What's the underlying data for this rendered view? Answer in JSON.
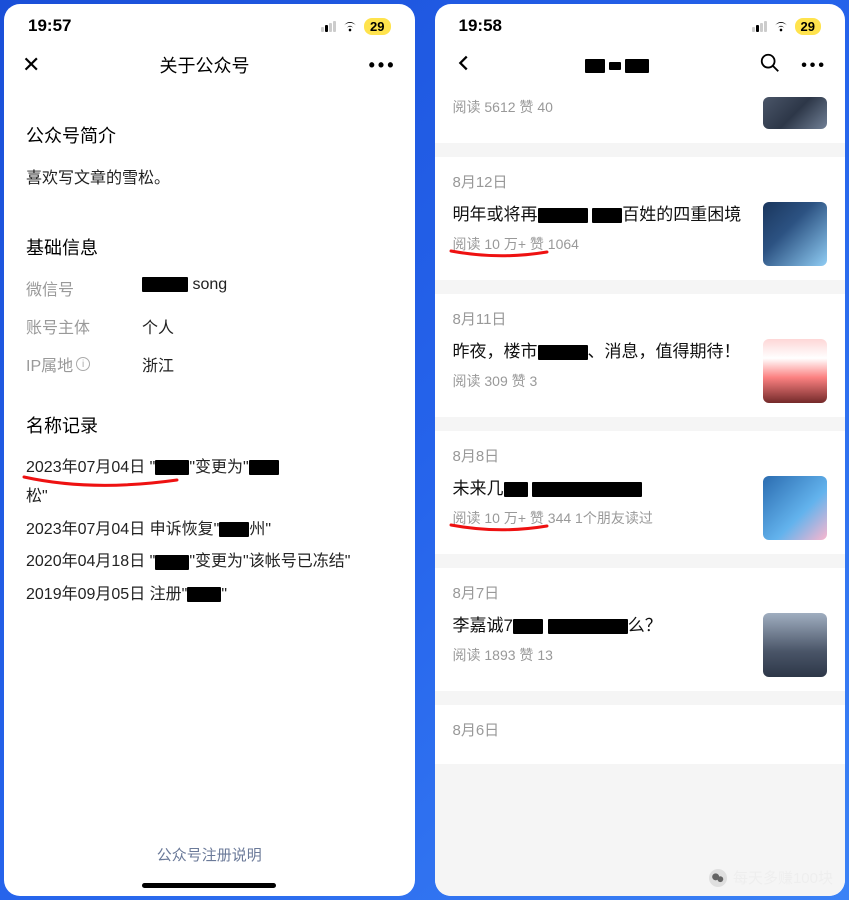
{
  "left": {
    "time": "19:57",
    "battery": "29",
    "nav_title": "关于公众号",
    "section_intro_title": "公众号简介",
    "intro_text": "喜欢写文章的雪松。",
    "section_basic_title": "基础信息",
    "rows": {
      "wechat_label": "微信号",
      "wechat_value": "song",
      "subject_label": "账号主体",
      "subject_value": "个人",
      "ip_label": "IP属地",
      "ip_value": "浙江"
    },
    "section_history_title": "名称记录",
    "history": [
      "2023年07月04日 \"▇▇▇\"变更为\"▇▇松\"",
      "2023年07月04日 申诉恢复\"▇▇州\"",
      "2020年04月18日 \"▇▇▇\"变更为\"该帐号已冻结\"",
      "2019年09月05日 注册\"▇▇▇\""
    ],
    "footer_link": "公众号注册说明"
  },
  "right": {
    "time": "19:58",
    "battery": "29",
    "top_stats": "阅读 5612  赞 40",
    "articles": [
      {
        "date": "8月12日",
        "title_prefix": "明年或将再",
        "title_suffix": "百姓的四重困境",
        "stats": "阅读 10 万+  赞 1064",
        "red_underline": true
      },
      {
        "date": "8月11日",
        "title_prefix": "昨夜，楼市",
        "title_suffix": "消息，值得期待！",
        "stats": "阅读 309  赞 3"
      },
      {
        "date": "8月8日",
        "title_prefix": "未来几",
        "title_suffix": "",
        "stats": "阅读 10 万+  赞 344  1个朋友读过",
        "red_underline": true
      },
      {
        "date": "8月7日",
        "title_prefix": "李嘉诚7",
        "title_suffix": "么？",
        "stats": "阅读 1893  赞 13"
      },
      {
        "date": "8月6日",
        "title_prefix": "",
        "title_suffix": "",
        "stats": ""
      }
    ]
  },
  "watermark": "每天多赚100块"
}
